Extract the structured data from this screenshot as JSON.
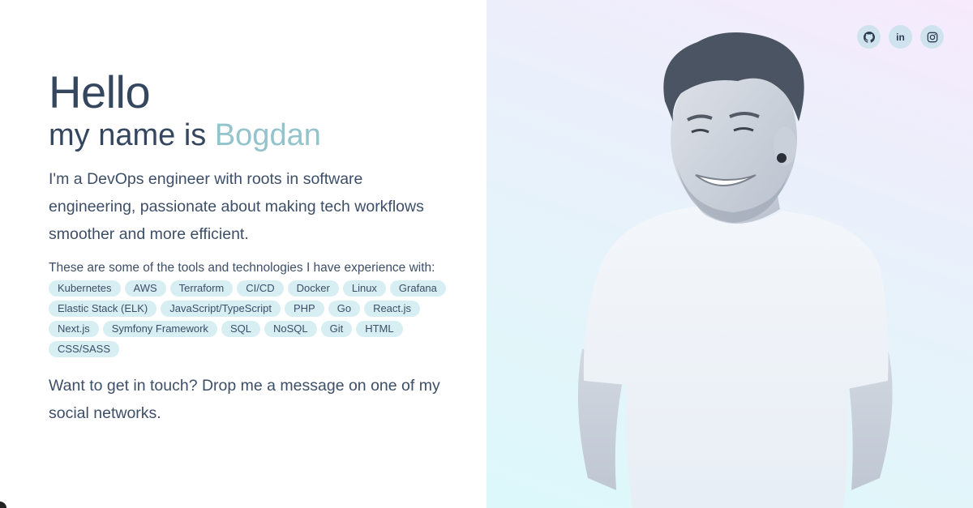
{
  "hero": {
    "hello": "Hello",
    "name_prefix": "my name is ",
    "name": "Bogdan",
    "intro": "I'm a DevOps engineer with roots in software engineering, passionate about making tech workflows smoother and more efficient.",
    "tools_label": "These are some of the tools and technologies I have experience with:",
    "tools": [
      "Kubernetes",
      "AWS",
      "Terraform",
      "CI/CD",
      "Docker",
      "Linux",
      "Grafana",
      "Elastic Stack (ELK)",
      "JavaScript/TypeScript",
      "PHP",
      "Go",
      "React.js",
      "Next.js",
      "Symfony Framework",
      "SQL",
      "NoSQL",
      "Git",
      "HTML",
      "CSS/SASS"
    ],
    "contact": "Want to get in touch? Drop me a message on one of my social networks."
  },
  "socials": [
    {
      "icon": "github-icon",
      "label": ""
    },
    {
      "icon": "linkedin-icon",
      "label": "in"
    },
    {
      "icon": "instagram-icon",
      "label": ""
    }
  ],
  "colors": {
    "text": "#34475f",
    "accent": "#93c3cc",
    "tag_bg": "#d7eef2",
    "social_bg": "#cfe3ee"
  }
}
